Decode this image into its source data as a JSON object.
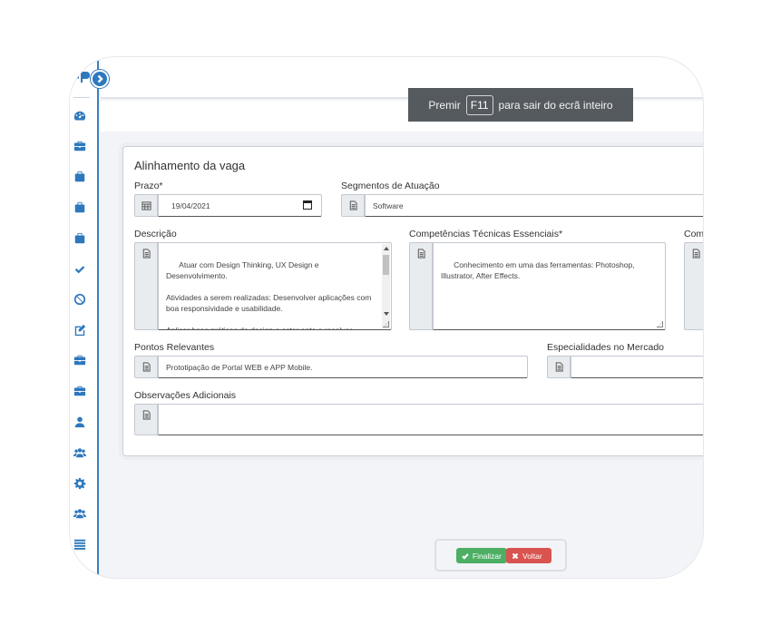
{
  "fullscreen_tip": {
    "before": "Premir",
    "key": "F11",
    "after": "para sair do ecrã inteiro"
  },
  "form": {
    "title": "Alinhamento da vaga",
    "deadline": {
      "label": "Prazo*",
      "value": "19/04/2021"
    },
    "segments": {
      "label": "Segmentos de Atuação",
      "value": "Software"
    },
    "description": {
      "label": "Descrição",
      "value": "Atuar com Design Thinking, UX Design e Desenvolvimento.\n\nAtividades a serem realizadas: Desenvolver aplicações com boa responsividade e usabilidade.\n\nAplicar boas práticas de design e estar apto a resolver problemas de interface e experiência do usuário."
    },
    "technical_skills": {
      "label": "Competências Técnicas Essenciais*",
      "value": "Conhecimento em uma das ferramentas: Photoshop, Illustrator, After Effects."
    },
    "third_column": {
      "label": "Comp"
    },
    "key_points": {
      "label": "Pontos Relevantes",
      "value": "Prototipação de Portal WEB e APP Mobile."
    },
    "market_specialties": {
      "label": "Especialidades no Mercado",
      "value": ""
    },
    "additional_notes": {
      "label": "Observações Adicionais",
      "value": ""
    }
  },
  "actions": {
    "finish": "Finalizar",
    "back": "Voltar"
  },
  "sidebar": {
    "icons": [
      "dashboard-icon",
      "briefcase-icon",
      "suitcase-icon",
      "suitcase-icon",
      "suitcase-icon",
      "check-icon",
      "ban-icon",
      "edit-icon",
      "briefcase-icon",
      "briefcase-icon",
      "user-icon",
      "users-icon",
      "gear-icon",
      "users-icon",
      "list-icon"
    ]
  },
  "colors": {
    "accent": "#2e78bd",
    "success": "#4caf64",
    "danger": "#d9534f"
  }
}
